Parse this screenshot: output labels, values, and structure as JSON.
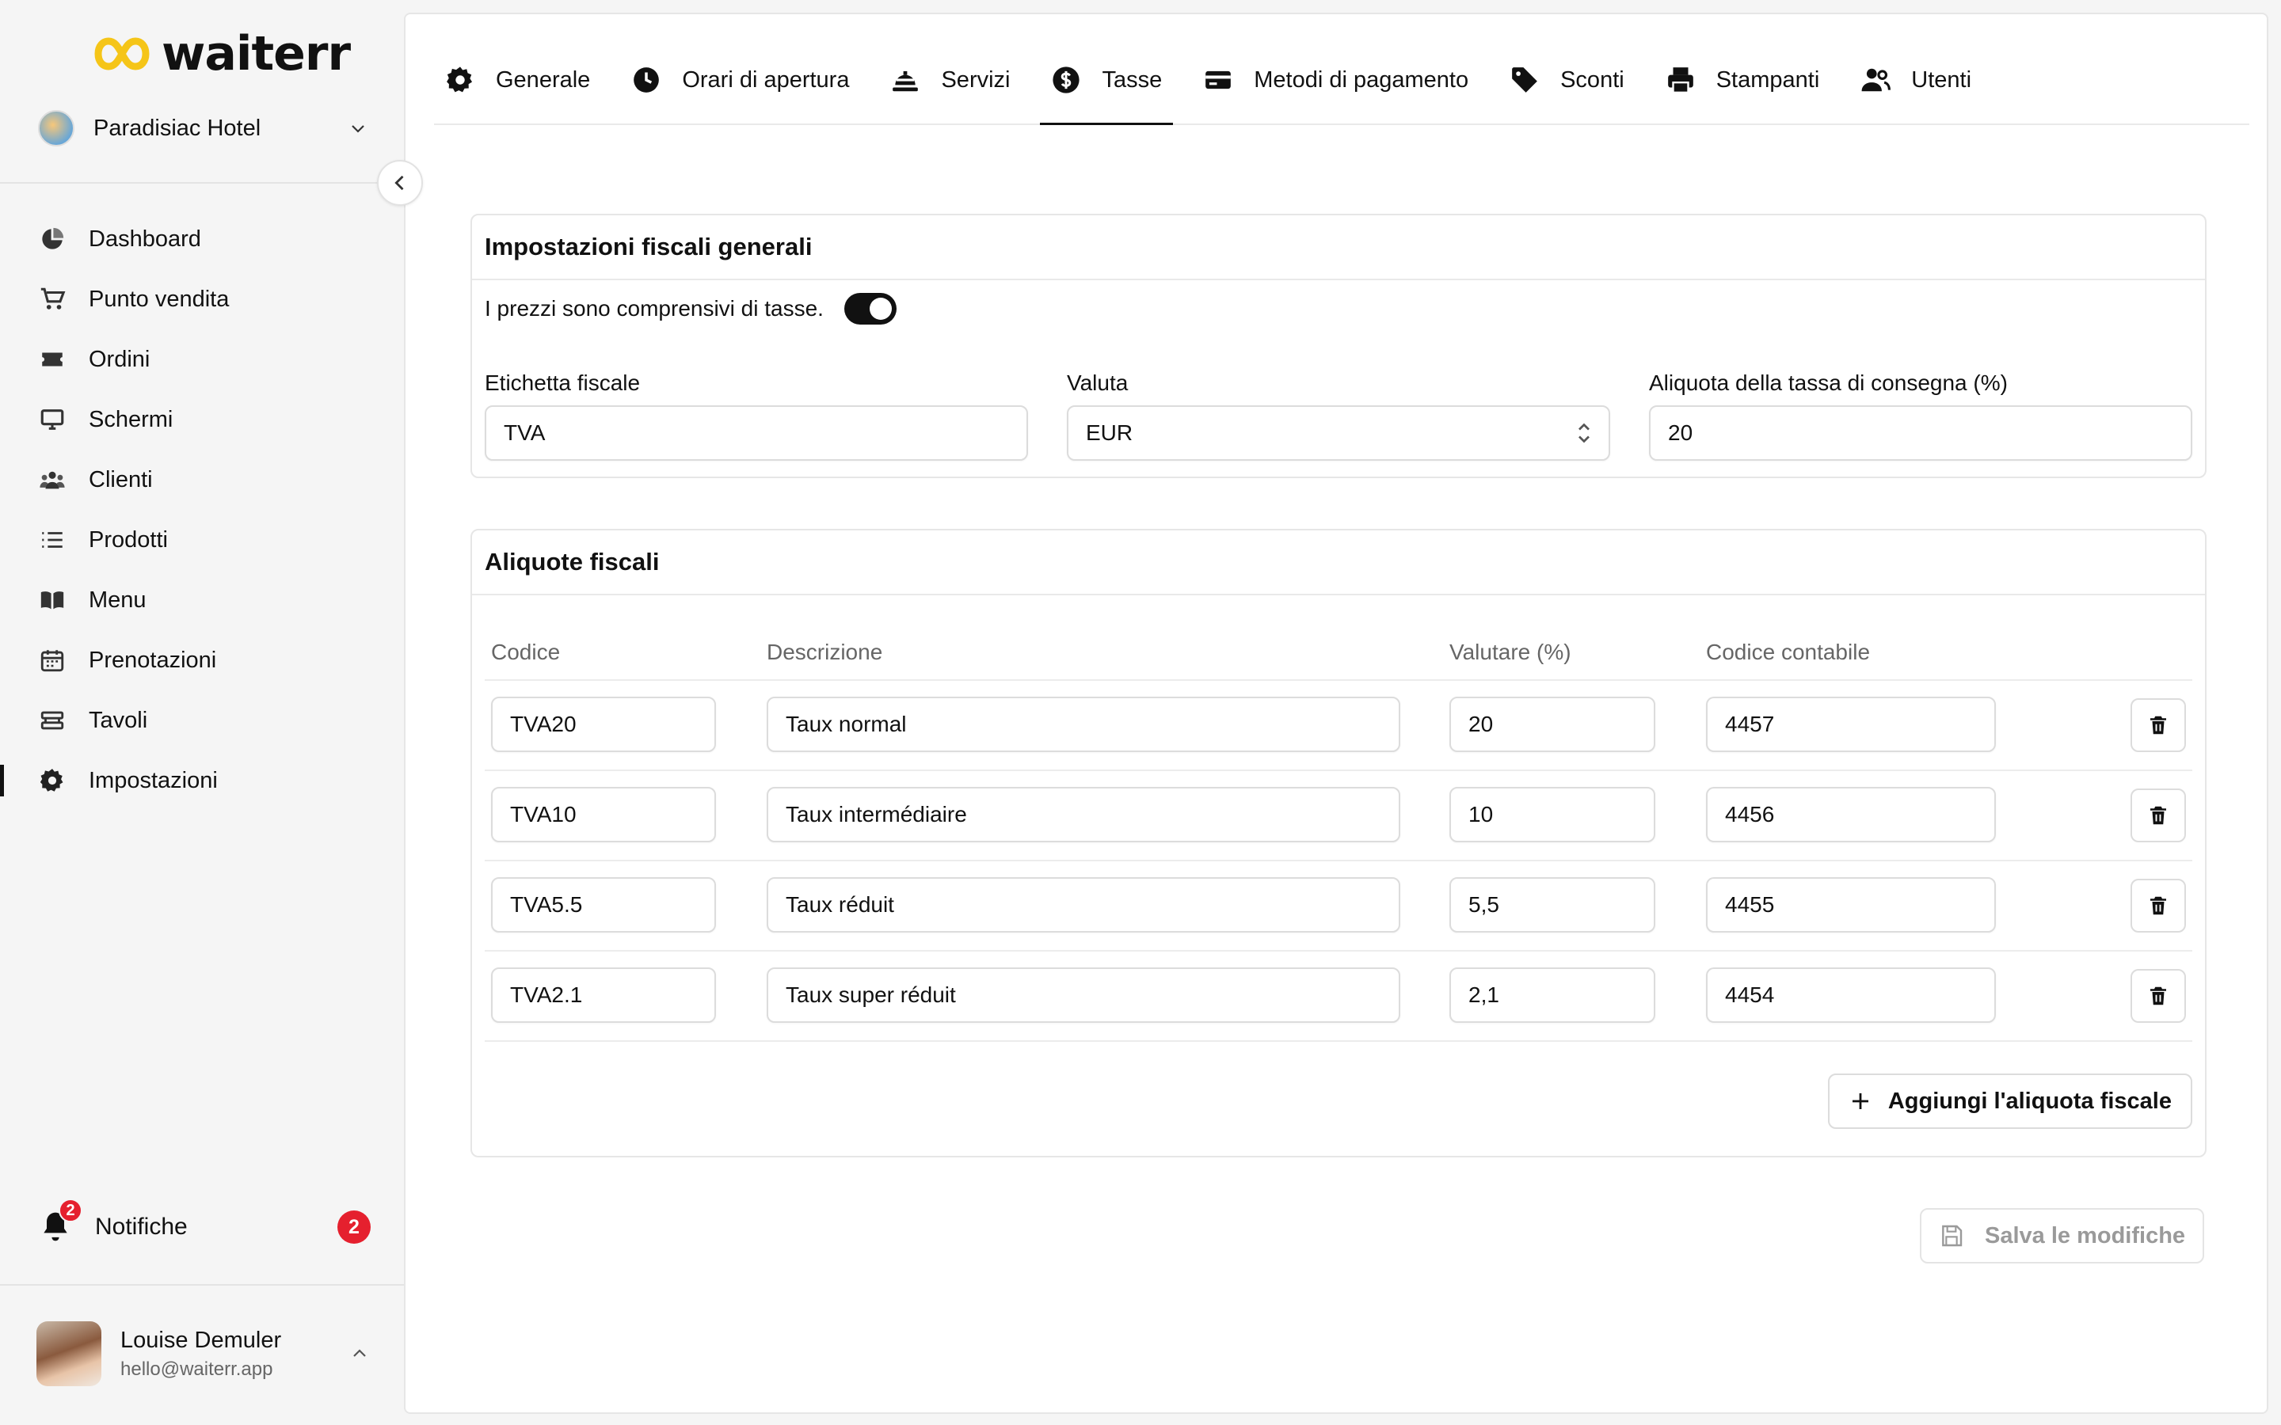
{
  "app": {
    "brand": "waiterr",
    "accent": "#F5C518"
  },
  "hotel": {
    "name": "Paradisiac Hotel"
  },
  "sidebar": {
    "items": [
      {
        "label": "Dashboard",
        "icon": "chart-pie-icon"
      },
      {
        "label": "Punto vendita",
        "icon": "cart-icon"
      },
      {
        "label": "Ordini",
        "icon": "ticket-icon"
      },
      {
        "label": "Schermi",
        "icon": "monitor-icon"
      },
      {
        "label": "Clienti",
        "icon": "users-group-icon"
      },
      {
        "label": "Prodotti",
        "icon": "list-icon"
      },
      {
        "label": "Menu",
        "icon": "book-open-icon"
      },
      {
        "label": "Prenotazioni",
        "icon": "calendar-icon"
      },
      {
        "label": "Tavoli",
        "icon": "table-icon"
      },
      {
        "label": "Impostazioni",
        "icon": "gear-icon",
        "active": true
      }
    ],
    "notifications": {
      "label": "Notifiche",
      "count": "2"
    }
  },
  "user": {
    "name": "Louise Demuler",
    "email": "hello@waiterr.app"
  },
  "tabs": [
    {
      "label": "Generale",
      "icon": "gear-icon"
    },
    {
      "label": "Orari di apertura",
      "icon": "clock-icon"
    },
    {
      "label": "Servizi",
      "icon": "cloche-icon"
    },
    {
      "label": "Tasse",
      "icon": "dollar-circle-icon",
      "active": true
    },
    {
      "label": "Metodi di pagamento",
      "icon": "credit-card-icon"
    },
    {
      "label": "Sconti",
      "icon": "tag-icon"
    },
    {
      "label": "Stampanti",
      "icon": "printer-icon"
    },
    {
      "label": "Utenti",
      "icon": "users-icon"
    }
  ],
  "general": {
    "title": "Impostazioni fiscali generali",
    "toggle_label": "I prezzi sono comprensivi di tasse.",
    "toggle_on": true,
    "tax_label_field": {
      "label": "Etichetta fiscale",
      "value": "TVA"
    },
    "currency_field": {
      "label": "Valuta",
      "value": "EUR"
    },
    "delivery_rate_field": {
      "label": "Aliquota della tassa di consegna (%)",
      "value": "20"
    }
  },
  "rates": {
    "title": "Aliquote fiscali",
    "columns": [
      "Codice",
      "Descrizione",
      "Valutare (%)",
      "Codice contabile"
    ],
    "rows": [
      {
        "code": "TVA20",
        "description": "Taux normal",
        "rate": "20",
        "account": "4457"
      },
      {
        "code": "TVA10",
        "description": "Taux intermédiaire",
        "rate": "10",
        "account": "4456"
      },
      {
        "code": "TVA5.5",
        "description": "Taux réduit",
        "rate": "5,5",
        "account": "4455"
      },
      {
        "code": "TVA2.1",
        "description": "Taux super réduit",
        "rate": "2,1",
        "account": "4454"
      }
    ],
    "add_label": "Aggiungi l'aliquota fiscale"
  },
  "save_label": "Salva le modifiche"
}
